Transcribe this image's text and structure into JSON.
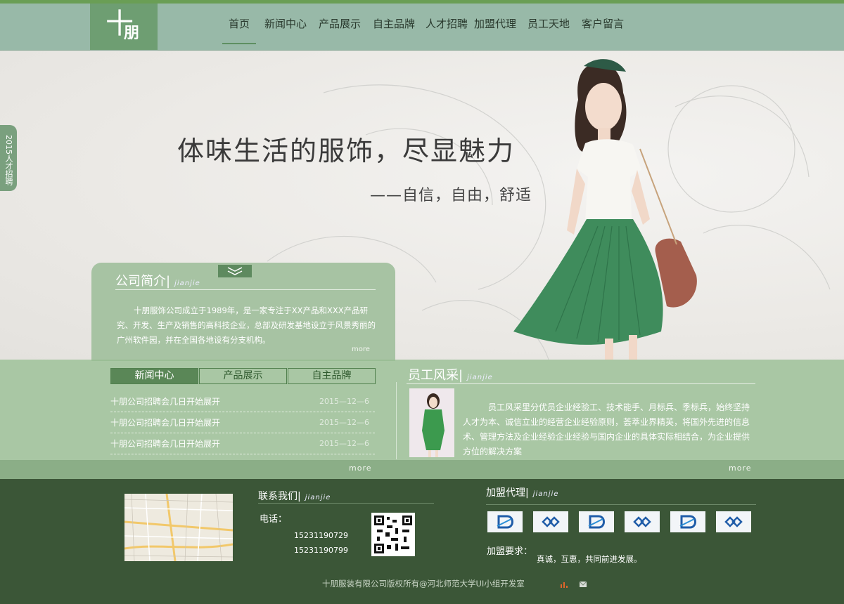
{
  "header": {
    "logo": {
      "line1": "十",
      "line2": "朋"
    },
    "nav": [
      {
        "label": "首页",
        "active": true
      },
      {
        "label": "新闻中心"
      },
      {
        "label": "产品展示"
      },
      {
        "label": "自主品牌"
      },
      {
        "label": "人才招聘"
      },
      {
        "label": "加盟代理"
      },
      {
        "label": "员工天地"
      },
      {
        "label": "客户留言"
      }
    ]
  },
  "side_tab": {
    "label": "2015人才招聘"
  },
  "hero": {
    "title": "体味生活的服饰，尽显魅力",
    "subtitle": "——自信，自由，舒适"
  },
  "intro": {
    "title": "公司简介|",
    "title_en": "jianjie",
    "text": "十朋服饰公司成立于1989年，是一家专注于XX产品和XXX产品研究、开发、生产及销售的高科技企业，总部及研发基地设立于风景秀丽的广州软件园，并在全国各地设有分支机构。",
    "more": "more"
  },
  "news": {
    "tabs": [
      "新闻中心",
      "产品展示",
      "自主品牌"
    ],
    "rows": [
      {
        "title": "十朋公司招聘会几日开始展开",
        "date": "2015—12—6"
      },
      {
        "title": "十朋公司招聘会几日开始展开",
        "date": "2015—12—6"
      },
      {
        "title": "十朋公司招聘会几日开始展开",
        "date": "2015—12—6"
      }
    ],
    "more": "more"
  },
  "staff": {
    "title": "员工风采|",
    "title_en": "jianjie",
    "text": "员工风采里分优员企业经验工、技术能手、月标兵、季标兵，始终坚持人才为本、诚信立业的经营企业经验原则，荟萃业界精英，将国外先进的信息术、管理方法及企业经验企业经验与国内企业的具体实际相结合，为企业提供方位的解决方案",
    "more": "more"
  },
  "footer": {
    "contact_title": "联系我们|",
    "contact_en": "jianjie",
    "phone_label": "电话：",
    "phones": [
      "15231190729",
      "15231190799"
    ],
    "join_title": "加盟代理|",
    "join_en": "jianjie",
    "join_req_label": "加盟要求：",
    "join_req": "真诚，互惠，共同前进发展。",
    "copyright": "十朋服装有限公司版权所有@河北师范大学UI小组开发室"
  },
  "colors": {
    "accent": "#6e9e72",
    "footer": "#3b5637",
    "band": "#96bc91"
  }
}
